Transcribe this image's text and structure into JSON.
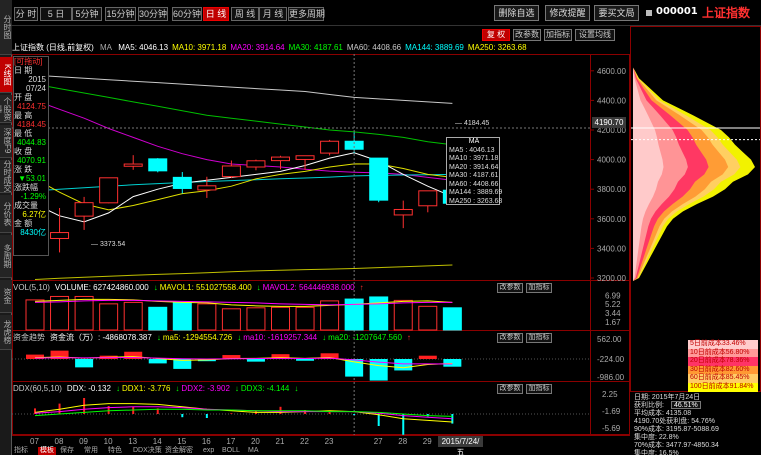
{
  "sidebar": {
    "tabs": [
      "分时图",
      "K线图",
      "个股资料",
      "深度F9",
      "分时成交",
      "分价表",
      "多周期",
      "资金",
      "龙虎榜"
    ]
  },
  "toolbar": {
    "periods": [
      "分 时",
      "5 日",
      "5分钟",
      "15分钟",
      "30分钟",
      "60分钟",
      "日 线",
      "周 线",
      "月 线",
      "更多周期"
    ],
    "active_period": "日 线",
    "actions": [
      "删除自选",
      "修改提醒",
      "要买文局"
    ],
    "stock_code": "000001",
    "stock_name": "上证指数"
  },
  "main": {
    "title": "上证指数 (日线,前复权)",
    "ma_prefix": "MA",
    "ma_labels": [
      {
        "text": "MA5: 4046.13",
        "color": "#ffffff"
      },
      {
        "text": "MA10: 3971.18",
        "color": "#ffff00"
      },
      {
        "text": "MA20: 3914.64",
        "color": "#ff00ff"
      },
      {
        "text": "MA30: 4187.61",
        "color": "#00ff00"
      },
      {
        "text": "MA60: 4408.66",
        "color": "#c8c8c8"
      },
      {
        "text": "MA144: 3889.69",
        "color": "#00ffff"
      },
      {
        "text": "MA250: 3263.68",
        "color": "#ffff00"
      }
    ],
    "buttons": {
      "fuquan": "复 权",
      "canshu": "改参数",
      "zhibiao": "加指标",
      "kline": "设置均线"
    },
    "price_axis": [
      "4600.00",
      "4400.00",
      "4200.00",
      "4000.00",
      "3800.00",
      "3600.00",
      "3400.00",
      "3200.00"
    ],
    "hover_price": "4190.70",
    "annot_high": "4184.45",
    "annot_low": "3373.54"
  },
  "info_panel": {
    "header": "[可拖动]",
    "date_label": "日  期",
    "date_year": "2015",
    "date_md": "07/24",
    "open_label": "开  盘",
    "open": "4124.75",
    "high_label": "最  高",
    "high": "4184.45",
    "low_label": "最  低",
    "low": "4044.83",
    "close_label": "收  盘",
    "close": "4070.91",
    "change_label": "涨  跌",
    "change": "▼53.01",
    "pct_label": "涨跌幅",
    "pct": "-1.29%",
    "vol_label": "成交量",
    "vol": "6.27亿",
    "amt_label": "金  额",
    "amt": "8430亿"
  },
  "tooltip": {
    "title": "MA",
    "lines": [
      "MA5 : 4046.13",
      "MA10 : 3971.18",
      "MA20 : 3914.64",
      "MA30 : 4187.61",
      "MA60 : 4408.66",
      "MA144 : 3889.69",
      "MA250 : 3263.68"
    ]
  },
  "volume": {
    "header": [
      {
        "text": "VOL(5,10)",
        "color": "#c8c8c8"
      },
      {
        "text": "VOLUME: 627424860.000",
        "color": "#ffffff"
      },
      {
        "text": "↓",
        "color": "#00ff00"
      },
      {
        "text": "MAVOL1: 551027558.400",
        "color": "#ffff00"
      },
      {
        "text": "↓",
        "color": "#00ff00"
      },
      {
        "text": "MAVOL2: 564446938.000",
        "color": "#ff00ff"
      },
      {
        "text": "↑",
        "color": "#ff3030"
      }
    ],
    "axis": [
      "6.99",
      "5.22",
      "3.44",
      "1.67"
    ]
  },
  "money": {
    "header": [
      {
        "text": "资金趋势",
        "color": "#c8c8c8"
      },
      {
        "text": "资金流（万）: -4868078.387",
        "color": "#ffffff"
      },
      {
        "text": "↓",
        "color": "#00ff00"
      },
      {
        "text": "ma5: -1294554.726",
        "color": "#ffff00"
      },
      {
        "text": "↓",
        "color": "#00ff00"
      },
      {
        "text": "ma10: -1619257.344",
        "color": "#ff00ff"
      },
      {
        "text": "↓",
        "color": "#00ff00"
      },
      {
        "text": "ma20: -1207647.560",
        "color": "#00ff00"
      },
      {
        "text": "↑",
        "color": "#ff3030"
      }
    ],
    "axis": [
      "562.00",
      "-224.00",
      "-986.00"
    ]
  },
  "ddx": {
    "header": [
      {
        "text": "DDX(60,5,10)",
        "color": "#c8c8c8"
      },
      {
        "text": "DDX: -0.132",
        "color": "#ffffff"
      },
      {
        "text": "↓",
        "color": "#00ff00"
      },
      {
        "text": "DDX1: -3.776",
        "color": "#ffff00"
      },
      {
        "text": "↓",
        "color": "#00ff00"
      },
      {
        "text": "DDX2: -3.902",
        "color": "#ff00ff"
      },
      {
        "text": "↓",
        "color": "#00ff00"
      },
      {
        "text": "DDX3: -4.144",
        "color": "#00ff00"
      },
      {
        "text": "↓",
        "color": "#00ff00"
      }
    ],
    "axis": [
      "2.25",
      "-1.69",
      "-5.69"
    ]
  },
  "x_axis": {
    "labels": [
      "07",
      "08",
      "09",
      "10",
      "13",
      "14",
      "15",
      "16",
      "17",
      "20",
      "21",
      "22",
      "23",
      "27",
      "28",
      "29",
      "30"
    ],
    "hover": "2015/7/24/五"
  },
  "bottom_tabs": {
    "items": [
      "指标",
      "模板",
      "保存",
      "常用",
      "特色",
      "DDX决策",
      "资金解密",
      "exp",
      "BOLL",
      "MA"
    ],
    "active": "模板"
  },
  "chip": {
    "legend": [
      {
        "text": "5日前成本33.46%",
        "bg": "#ffcccc"
      },
      {
        "text": "10日前成本56.80%",
        "bg": "#ff9999"
      },
      {
        "text": "20日前成本78.36%",
        "bg": "#ff3366"
      },
      {
        "text": "30日前成本82.60%",
        "bg": "#ff9933"
      },
      {
        "text": "60日前成本85.45%",
        "bg": "#ffcc66"
      },
      {
        "text": "100日前成本91.84%",
        "bg": "#ffff00"
      }
    ],
    "date": "日期: 2015年7月24日",
    "profit_label": "获利比例:",
    "profit_value": "46.51%",
    "lines": [
      "平均成本: 4135.08",
      "4190.70处获利盘: 54.76%",
      "90%成本: 3195.87-5088.69",
      "集中度: 22.8%",
      "70%成本: 3477.97-4850.34",
      "集中度: 16.5%"
    ]
  },
  "chart_data": {
    "type": "candlestick",
    "title": "上证指数 (日线,前复权)",
    "categories": [
      "07",
      "08",
      "09",
      "10",
      "13",
      "14",
      "15",
      "16",
      "17",
      "20",
      "21",
      "22",
      "23",
      "24",
      "27",
      "28",
      "29",
      "30"
    ],
    "ohlc": [
      [
        3654,
        3748,
        3640,
        3727
      ],
      [
        3467,
        3673,
        3373,
        3507
      ],
      [
        3618,
        3748,
        3525,
        3709
      ],
      [
        3708,
        3877,
        3705,
        3877
      ],
      [
        3955,
        4030,
        3931,
        3970
      ],
      [
        4005,
        4010,
        3914,
        3924
      ],
      [
        3880,
        3916,
        3771,
        3805
      ],
      [
        3795,
        3884,
        3741,
        3823
      ],
      [
        3885,
        3994,
        3875,
        3957
      ],
      [
        3950,
        4000,
        3928,
        3992
      ],
      [
        3993,
        4026,
        3935,
        4017
      ],
      [
        4001,
        4027,
        3930,
        4026
      ],
      [
        4044,
        4133,
        4028,
        4124
      ],
      [
        4124,
        4184,
        4044,
        4070
      ],
      [
        4010,
        4011,
        3712,
        3726
      ],
      [
        3626,
        3723,
        3537,
        3663
      ],
      [
        3688,
        3790,
        3644,
        3789
      ],
      [
        3793,
        3802,
        3705,
        3705
      ]
    ],
    "y_range": [
      3200,
      4700
    ],
    "volume_range": [
      0,
      7.5
    ],
    "volumes": [
      6.1,
      6.8,
      6.8,
      5.3,
      5.6,
      4.6,
      5.6,
      5.3,
      4.3,
      4.5,
      4.6,
      4.6,
      5.9,
      6.27,
      6.7,
      6.0,
      4.8,
      4.5
    ],
    "money_flow": [
      200,
      380,
      -380,
      150,
      330,
      -200,
      -450,
      -100,
      180,
      -120,
      220,
      -80,
      260,
      -800,
      -980,
      -520,
      150,
      -350
    ],
    "ddx": [
      0.7,
      1.3,
      2.0,
      1.0,
      0.9,
      0.7,
      -0.4,
      -0.5,
      0.1,
      0.4,
      0.9,
      0.5,
      0.3,
      -0.13,
      -1.5,
      -2.6,
      -0.3,
      -1.2
    ]
  }
}
